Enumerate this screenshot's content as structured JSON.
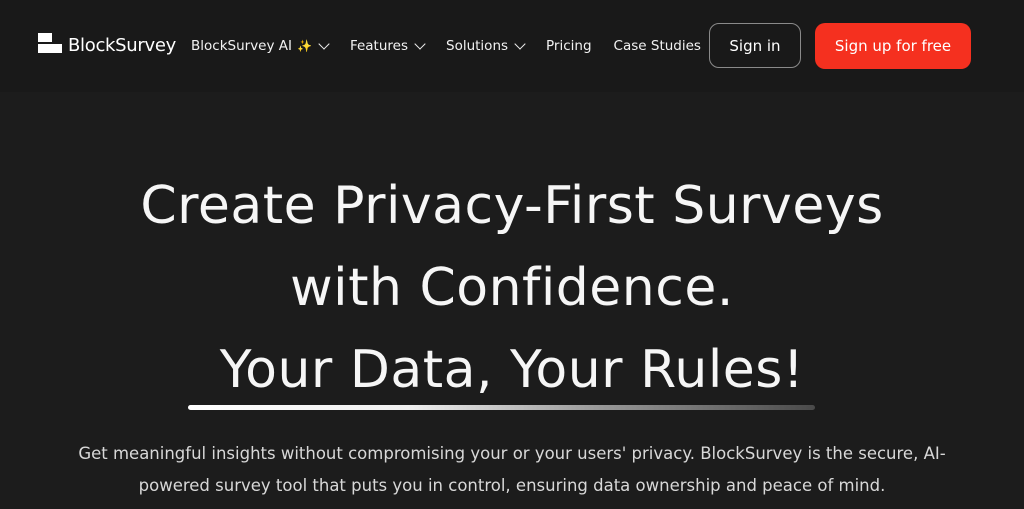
{
  "brand": {
    "name": "BlockSurvey"
  },
  "nav": {
    "items": [
      {
        "label": "BlockSurvey AI",
        "sparkle": "✨",
        "has_dropdown": true
      },
      {
        "label": "Features",
        "has_dropdown": true
      },
      {
        "label": "Solutions",
        "has_dropdown": true
      },
      {
        "label": "Pricing",
        "has_dropdown": false
      },
      {
        "label": "Case Studies",
        "has_dropdown": false
      }
    ],
    "signin_label": "Sign in",
    "signup_label": "Sign up for free"
  },
  "hero": {
    "line1": "Create Privacy-First Surveys",
    "line2": "with Confidence.",
    "line3": "Your Data, Your Rules!",
    "subtitle_line1": "Get meaningful insights without compromising your or your users' privacy. BlockSurvey is the secure, AI-",
    "subtitle_line2": "powered survey tool that puts you in control, ensuring data ownership and peace of mind."
  },
  "colors": {
    "background": "#1c1c1c",
    "accent": "#f5301f",
    "text": "#ffffff"
  }
}
